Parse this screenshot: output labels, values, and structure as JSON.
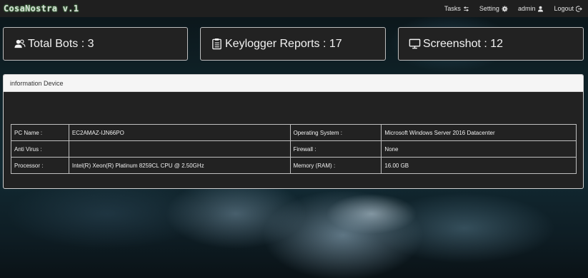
{
  "navbar": {
    "brand": "CosaNostra v.1",
    "links": [
      {
        "label": "Tasks",
        "icon": "tasks-icon"
      },
      {
        "label": "Setting",
        "icon": "gear-icon"
      },
      {
        "label": "admin",
        "icon": "user-icon"
      },
      {
        "label": "Logout",
        "icon": "logout-icon"
      }
    ]
  },
  "stats": [
    {
      "label": "Total Bots : 3",
      "icon": "users-icon"
    },
    {
      "label": "Keylogger Reports : 17",
      "icon": "clipboard-icon"
    },
    {
      "label": "Screenshot : 12",
      "icon": "monitor-icon"
    }
  ],
  "panel": {
    "heading": "information Device",
    "rows": [
      [
        "PC Name :",
        "EC2AMAZ-IJN66PO",
        "Operating System :",
        "Microsoft Windows Server 2016 Datacenter"
      ],
      [
        "Anti Virus :",
        "",
        "Firewall :",
        "None"
      ],
      [
        "Processor :",
        "Intel(R) Xeon(R) Platinum 8259CL CPU @ 2.50GHz",
        "Memory (RAM) :",
        "16.00 GB"
      ]
    ]
  },
  "colors": {
    "navbar_bg": "#1f1f1f",
    "card_bg": "#222222",
    "panel_heading_bg": "#f5f5f5",
    "brand_glow": "#6ccf6c"
  }
}
